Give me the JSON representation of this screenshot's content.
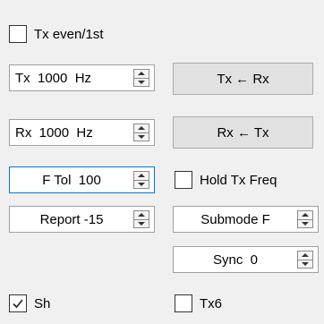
{
  "tx_even": {
    "label": "Tx even/1st",
    "checked": false
  },
  "tx_freq": {
    "label": "Tx  1000  Hz"
  },
  "rx_freq": {
    "label": "Rx  1000  Hz"
  },
  "tx_from_rx_button": {
    "label": "Tx ← Rx"
  },
  "rx_from_tx_button": {
    "label": "Rx ← Tx"
  },
  "f_tol": {
    "label": "F Tol  100"
  },
  "hold_tx_freq": {
    "label": "Hold Tx Freq",
    "checked": false
  },
  "report": {
    "label": "Report -15"
  },
  "submode": {
    "label": "Submode F"
  },
  "sync": {
    "label": "Sync  0"
  },
  "sh": {
    "label": "Sh",
    "checked": true
  },
  "tx6": {
    "label": "Tx6",
    "checked": false
  },
  "colors": {
    "focus_border": "#0078d7",
    "background": "#f0f0f0"
  }
}
